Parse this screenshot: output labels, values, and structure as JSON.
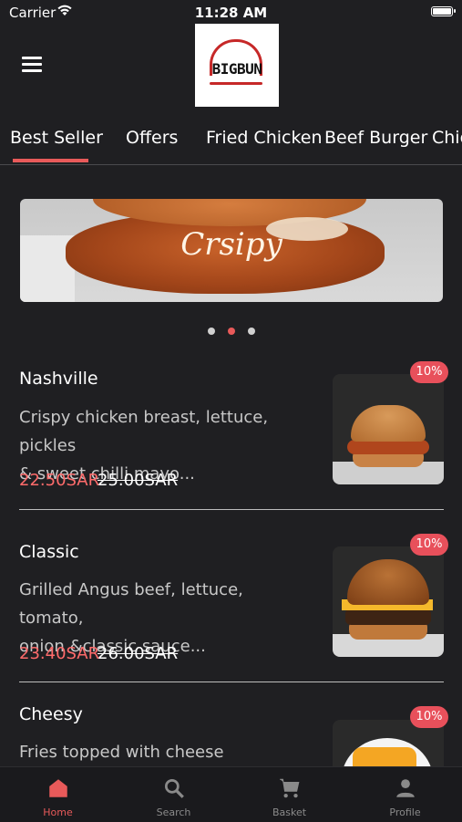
{
  "status_bar": {
    "carrier": "Carrier",
    "time": "11:28 AM"
  },
  "header": {
    "logo_text": "BIGBUN",
    "menu_icon": "hamburger-menu-icon"
  },
  "tabs": [
    {
      "label": "Best Seller",
      "active": true
    },
    {
      "label": "Offers"
    },
    {
      "label": "Fried Chicken"
    },
    {
      "label": "Beef Burger"
    },
    {
      "label": "Chic"
    }
  ],
  "banner": {
    "text": "Crsipy",
    "dot_count": 3,
    "active_dot": 2
  },
  "items": [
    {
      "name": "Nashville",
      "desc_line1": "Crispy chicken breast, lettuce, pickles",
      "desc_line2": "& sweet chilli mayo...",
      "price": "22.50SAR",
      "old_price": "25.00SAR",
      "badge": "10%"
    },
    {
      "name": "Classic",
      "desc_line1": "Grilled Angus beef, lettuce, tomato,",
      "desc_line2": "onion &classic sauce...",
      "price": "23.40SAR",
      "old_price": "26.00SAR",
      "badge": "10%"
    },
    {
      "name": "Cheesy",
      "desc_line1": "Fries topped with cheese",
      "badge": "10%"
    }
  ],
  "bottom_nav": [
    {
      "label": "Home",
      "icon": "home-icon",
      "active": true
    },
    {
      "label": "Search",
      "icon": "search-icon"
    },
    {
      "label": "Basket",
      "icon": "cart-icon"
    },
    {
      "label": "Profile",
      "icon": "person-icon"
    }
  ],
  "colors": {
    "background": "#1f1f22",
    "accent": "#e85a5a",
    "badge": "#e8505b"
  }
}
